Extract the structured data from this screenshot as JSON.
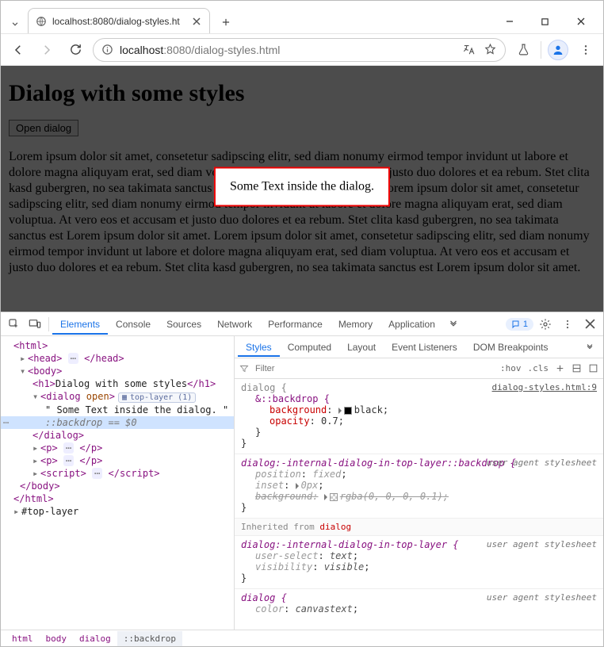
{
  "window": {
    "tab_title": "localhost:8080/dialog-styles.ht",
    "url_host": "localhost",
    "url_port": ":8080",
    "url_path": "/dialog-styles.html"
  },
  "page": {
    "heading": "Dialog with some styles",
    "open_button": "Open dialog",
    "paragraph": "Lorem ipsum dolor sit amet, consetetur sadipscing elitr, sed diam nonumy eirmod tempor invidunt ut labore et dolore magna aliquyam erat, sed diam voluptua. At vero eos et accusam et justo duo dolores et ea rebum. Stet clita kasd gubergren, no sea takimata sanctus est Lorem ipsum dolor sit amet. Lorem ipsum dolor sit amet, consetetur sadipscing elitr, sed diam nonumy eirmod tempor invidunt ut labore et dolore magna aliquyam erat, sed diam voluptua. At vero eos et accusam et justo duo dolores et ea rebum. Stet clita kasd gubergren, no sea takimata sanctus est Lorem ipsum dolor sit amet. Lorem ipsum dolor sit amet, consetetur sadipscing elitr, sed diam nonumy eirmod tempor invidunt ut labore et dolore magna aliquyam erat, sed diam voluptua. At vero eos et accusam et justo duo dolores et ea rebum. Stet clita kasd gubergren, no sea takimata sanctus est Lorem ipsum dolor sit amet.",
    "dialog_text": "Some Text inside the dialog."
  },
  "devtools": {
    "tabs": {
      "elements": "Elements",
      "console": "Console",
      "sources": "Sources",
      "network": "Network",
      "performance": "Performance",
      "memory": "Memory",
      "application": "Application"
    },
    "issues_count": "1",
    "elements_tree": {
      "html_open": "<html>",
      "head": "<head>",
      "head_close": "</head>",
      "body_open": "<body>",
      "h1_open": "<h1>",
      "h1_text": "Dialog with some styles",
      "h1_close": "</h1>",
      "dialog_open": "<dialog",
      "dialog_attr": " open",
      "dialog_open_end": ">",
      "top_layer_pill": "top-layer (1)",
      "dialog_text": "\" Some Text inside the dialog. \"",
      "backdrop_pseudo": "::backdrop",
      "eq0": " == $0",
      "dialog_close": "</dialog>",
      "p1": "<p>",
      "p1_close": "</p>",
      "p2": "<p>",
      "p2_close": "</p>",
      "script": "<script>",
      "script_close": "</script>",
      "body_close": "</body>",
      "html_close": "</html>",
      "top_layer_root": "#top-layer"
    },
    "breadcrumb": {
      "b0": "html",
      "b1": "body",
      "b2": "dialog",
      "b3": "::backdrop"
    },
    "subtabs": {
      "styles": "Styles",
      "computed": "Computed",
      "layout": "Layout",
      "event_listeners": "Event Listeners",
      "dom_breakpoints": "DOM Breakpoints"
    },
    "filter_placeholder": "Filter",
    "filter_right": {
      "hov": ":hov",
      "cls": ".cls"
    },
    "rules": {
      "r1": {
        "source": "dialog-styles.html:9",
        "sel1": "dialog {",
        "sel2": "&::backdrop {",
        "p_bg": "background",
        "v_bg": "black",
        "p_op": "opacity",
        "v_op": "0.7",
        "close": "}"
      },
      "r2": {
        "source": "user agent stylesheet",
        "sel": "dialog:-internal-dialog-in-top-layer::backdrop {",
        "p_pos": "position",
        "v_pos": "fixed",
        "p_inset": "inset",
        "v_inset": "0px",
        "p_bg": "background",
        "v_bg": "rgba(0, 0, 0, 0.1)",
        "close": "}"
      },
      "inherit_label": "Inherited from ",
      "inherit_from": "dialog",
      "r3": {
        "source": "user agent stylesheet",
        "sel": "dialog:-internal-dialog-in-top-layer {",
        "p_us": "user-select",
        "v_us": "text",
        "p_vis": "visibility",
        "v_vis": "visible",
        "close": "}"
      },
      "r4": {
        "source": "user agent stylesheet",
        "sel": "dialog {",
        "p_color": "color",
        "v_color": "canvastext",
        "close_ellipsis": ""
      }
    }
  }
}
